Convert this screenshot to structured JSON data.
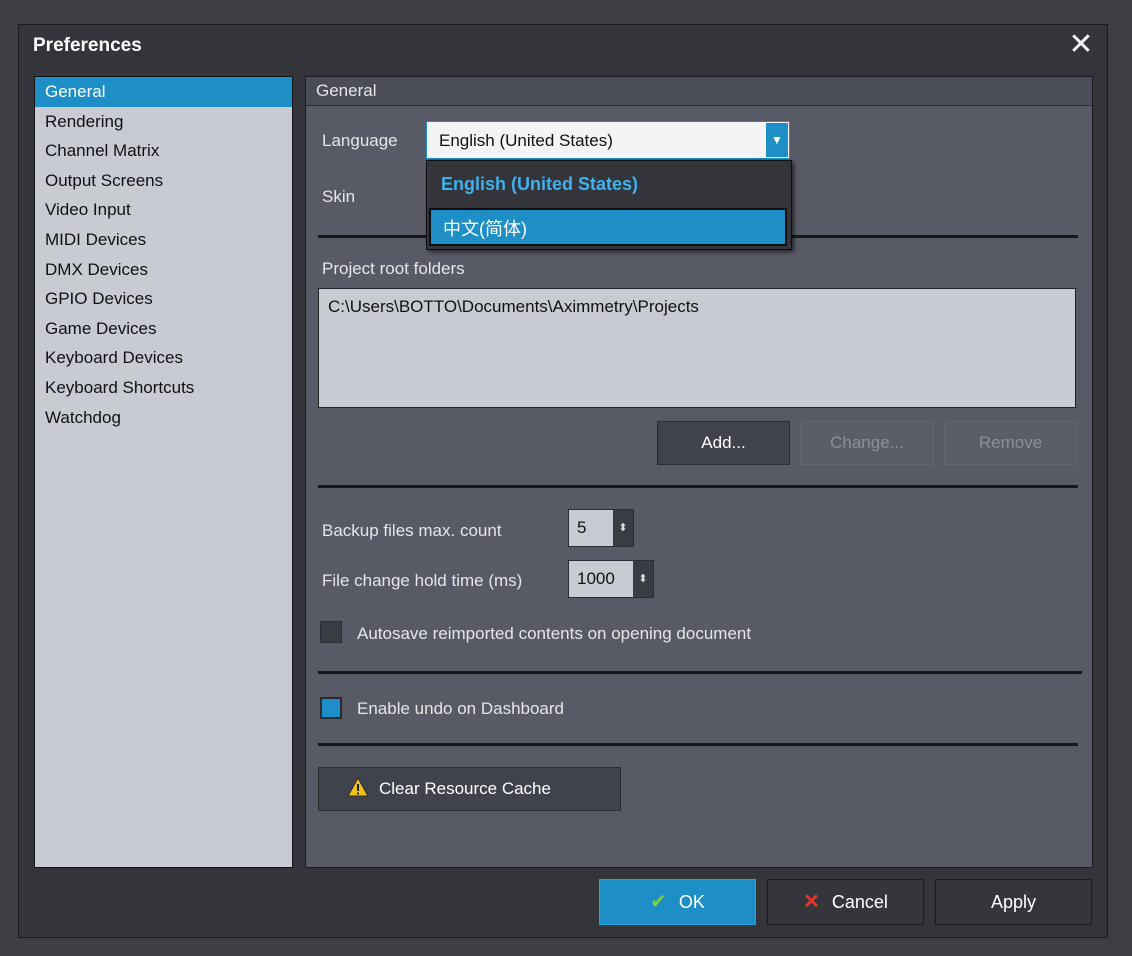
{
  "window": {
    "title": "Preferences"
  },
  "sidebar": {
    "items": [
      {
        "label": "General",
        "selected": true
      },
      {
        "label": "Rendering"
      },
      {
        "label": "Channel Matrix"
      },
      {
        "label": "Output Screens"
      },
      {
        "label": "Video Input"
      },
      {
        "label": "MIDI Devices"
      },
      {
        "label": "DMX Devices"
      },
      {
        "label": "GPIO Devices"
      },
      {
        "label": "Game Devices"
      },
      {
        "label": "Keyboard Devices"
      },
      {
        "label": "Keyboard Shortcuts"
      },
      {
        "label": "Watchdog"
      }
    ]
  },
  "general": {
    "header": "General",
    "language_label": "Language",
    "language_value": "English (United States)",
    "language_options": [
      "English (United States)",
      "中文(简体)"
    ],
    "skin_label": "Skin",
    "project_root_label": "Project root folders",
    "project_root_items": [
      "C:\\Users\\BOTTO\\Documents\\Aximmetry\\Projects"
    ],
    "add_label": "Add...",
    "change_label": "Change...",
    "remove_label": "Remove",
    "backup_label": "Backup files max. count",
    "backup_value": "5",
    "hold_label": "File change hold time (ms)",
    "hold_value": "1000",
    "autosave_label": "Autosave reimported contents on opening document",
    "autosave_checked": false,
    "undo_label": "Enable undo on Dashboard",
    "undo_checked": true,
    "clear_cache_label": "Clear Resource Cache"
  },
  "footer": {
    "ok_label": "OK",
    "cancel_label": "Cancel",
    "apply_label": "Apply"
  },
  "colors": {
    "accent": "#1e8fc6",
    "warning": "#f2c21a"
  }
}
